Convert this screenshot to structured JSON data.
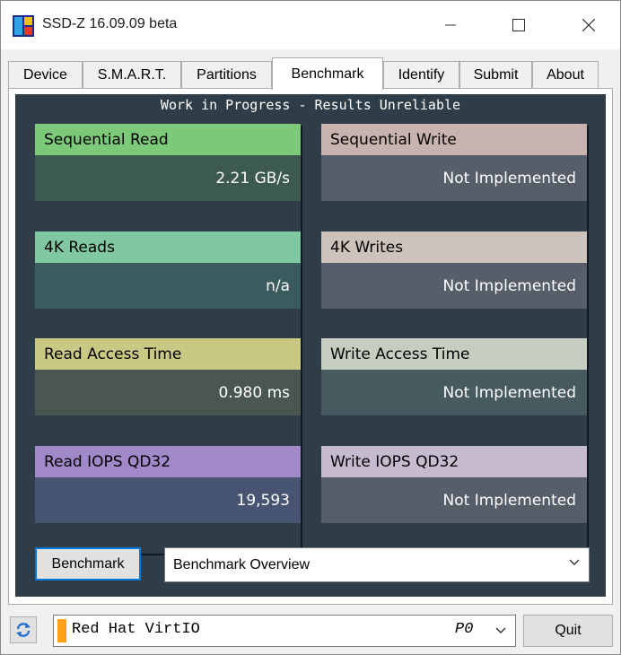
{
  "window": {
    "title": "SSD-Z 16.09.09 beta",
    "icon": "ssdz-app-icon"
  },
  "tabs": [
    {
      "label": "Device"
    },
    {
      "label": "S.M.A.R.T."
    },
    {
      "label": "Partitions"
    },
    {
      "label": "Benchmark",
      "active": true
    },
    {
      "label": "Identify"
    },
    {
      "label": "Submit"
    },
    {
      "label": "About"
    }
  ],
  "benchmark": {
    "notice": "Work in Progress - Results Unreliable",
    "cards": [
      {
        "title": "Sequential Read",
        "value": "2.21 GB/s",
        "header_color": "#7cc979",
        "body_color": "#3c5a50"
      },
      {
        "title": "Sequential Write",
        "value": "Not Implemented",
        "header_color": "#c9b3ae",
        "body_color": "#565e6a"
      },
      {
        "title": "4K Reads",
        "value": "n/a",
        "header_color": "#80c8a2",
        "body_color": "#3b5c5f"
      },
      {
        "title": "4K Writes",
        "value": "Not Implemented",
        "header_color": "#cdc3bb",
        "body_color": "#565e6a"
      },
      {
        "title": "Read Access Time",
        "value": "0.980 ms",
        "header_color": "#c9c985",
        "body_color": "#4a5650"
      },
      {
        "title": "Write Access Time",
        "value": "Not Implemented",
        "header_color": "#c5cec0",
        "body_color": "#475a60"
      },
      {
        "title": "Read IOPS QD32",
        "value": "19,593",
        "header_color": "#a088c9",
        "body_color": "#475573"
      },
      {
        "title": "Write IOPS QD32",
        "value": "Not Implemented",
        "header_color": "#c6bacf",
        "body_color": "#565e6a"
      }
    ],
    "run_button": "Benchmark",
    "view_select": "Benchmark Overview"
  },
  "footer": {
    "drive_name": "Red Hat VirtIO",
    "drive_index": "P0",
    "quit_button": "Quit"
  }
}
